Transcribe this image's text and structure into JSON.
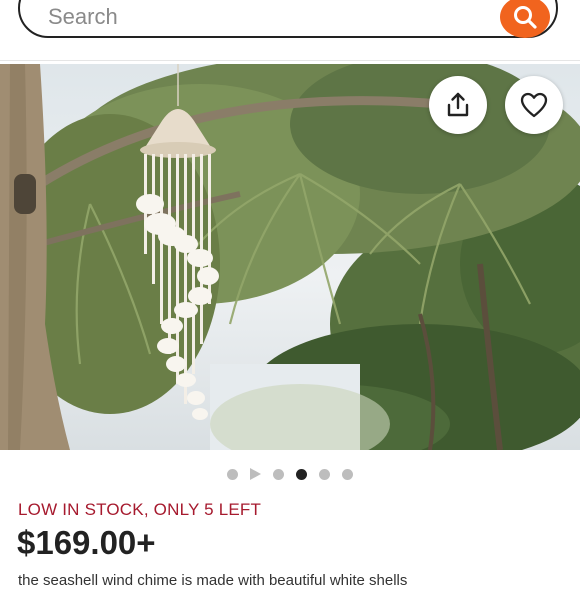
{
  "search": {
    "placeholder": "Search"
  },
  "listing": {
    "stock_note": "LOW IN STOCK, ONLY 5 LEFT",
    "price": "$169.00+",
    "description_peek": "the seashell wind chime is made with beautiful white shells"
  },
  "carousel": {
    "slide_count": 5,
    "active_index": 2,
    "has_video": true
  },
  "icons": {
    "search": "search-icon",
    "share": "share-icon",
    "favorite": "heart-icon"
  },
  "colors": {
    "accent": "#f1641e",
    "stock": "#a61a2e",
    "text": "#222222"
  }
}
